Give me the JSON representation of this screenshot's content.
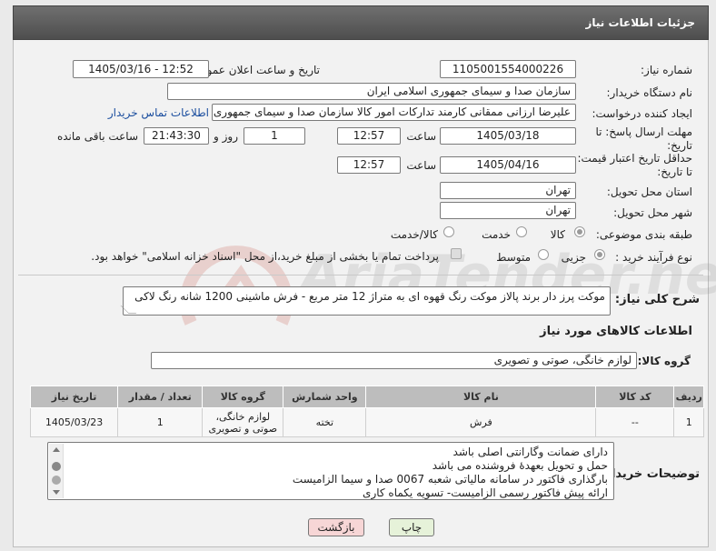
{
  "header": {
    "title": "جزئیات اطلاعات نیاز"
  },
  "form": {
    "need_number_label": "شماره نیاز:",
    "need_number": "1105001554000226",
    "announce_label": "تاریخ و ساعت اعلان عمومی:",
    "announce_value": "1405/03/16 - 12:52",
    "buyer_org_label": "نام دستگاه خریدار:",
    "buyer_org": "سازمان صدا و سیمای جمهوری اسلامی ایران",
    "creator_label": "ایجاد کننده درخواست:",
    "creator": "علیرضا ارزانی ممقانی کارمند تدارکات امور کالا سازمان صدا و سیمای جمهوری اسلامی ایران",
    "contact_link": "اطلاعات تماس خریدار",
    "reply_label": "مهلت ارسال پاسخ: تا تاریخ:",
    "reply_date": "1405/03/18",
    "time_label": "ساعت",
    "reply_time": "12:57",
    "days_value": "1",
    "days_label": "روز و",
    "remaining_time": "21:43:30",
    "remaining_label": "ساعت باقی مانده",
    "validity_label": "حداقل تاریخ اعتبار قیمت: تا تاریخ:",
    "validity_date": "1405/04/16",
    "validity_time": "12:57",
    "province_label": "استان محل تحویل:",
    "province": "تهران",
    "city_label": "شهر محل تحویل:",
    "city": "تهران",
    "category_label": "طبقه بندی موضوعی:",
    "category_options": [
      "کالا",
      "خدمت",
      "کالا/خدمت"
    ],
    "process_label": "نوع فرآیند خرید :",
    "process_options": [
      "جزیی",
      "متوسط"
    ],
    "payment_note": "پرداخت تمام یا بخشی از مبلغ خرید،از محل \"اسناد خزانه اسلامی\" خواهد بود."
  },
  "description": {
    "label": "شرح کلی نیاز:",
    "text": "موکت پرز دار برند پالاز موکت رنگ قهوه ای به متراژ 12 متر مربع - فرش ماشینی 1200 شانه رنگ لاکی"
  },
  "goods": {
    "section_title": "اطلاعات کالاهای مورد نیاز",
    "group_label": "گروه کالا:",
    "group_value": "لوازم خانگی، صوتی و تصویری",
    "columns": [
      "ردیف",
      "کد کالا",
      "نام کالا",
      "واحد شمارش",
      "گروه کالا",
      "تعداد / مقدار",
      "تاریخ نیاز"
    ],
    "rows": [
      {
        "row": "1",
        "code": "--",
        "name": "فرش",
        "unit": "تخته",
        "group_line1": "لوازم خانگی،",
        "group_line2": "صوتی و تصویری",
        "qty": "1",
        "date": "1405/03/23"
      }
    ]
  },
  "buyer_notes": {
    "label": "توضیحات خریدار:",
    "lines": [
      "دارای ضمانت وگارانتی اصلی باشد",
      "حمل و تحویل بعهدهٔ فروشنده می باشد",
      "بارگذاری فاکتور در سامانه مالیاتی شعبه 0067 صدا و سیما الزامیست",
      "ارائه پیش فاکتور رسمی الزامیست- تسویه یکماه کاری"
    ]
  },
  "buttons": {
    "print": "چاپ",
    "back": "بازگشت"
  },
  "watermark": {
    "text": "AriaTender.neT"
  },
  "colors": {
    "header": "#5a5a5a",
    "link": "#1a4d9e",
    "back_button": "#f7d6d6",
    "print_button": "#e6f2d9"
  }
}
